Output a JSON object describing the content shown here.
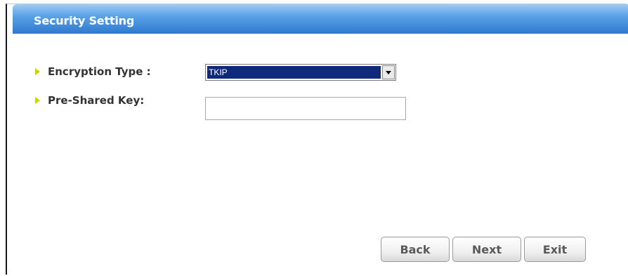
{
  "header": {
    "title": "Security Setting"
  },
  "form": {
    "encryption_type": {
      "label": "Encryption Type :",
      "value": "TKIP"
    },
    "pre_shared_key": {
      "label": "Pre-Shared Key:",
      "value": ""
    }
  },
  "buttons": {
    "back": "Back",
    "next": "Next",
    "exit": "Exit"
  },
  "colors": {
    "header_top": "#9fcbf3",
    "header_bottom": "#2f79cf",
    "bullet": "#c9d400",
    "selected_option_bg": "#0f2a7a"
  },
  "icons": {
    "bullet": "chevron-right-icon",
    "dropdown": "dropdown-arrow-icon"
  }
}
